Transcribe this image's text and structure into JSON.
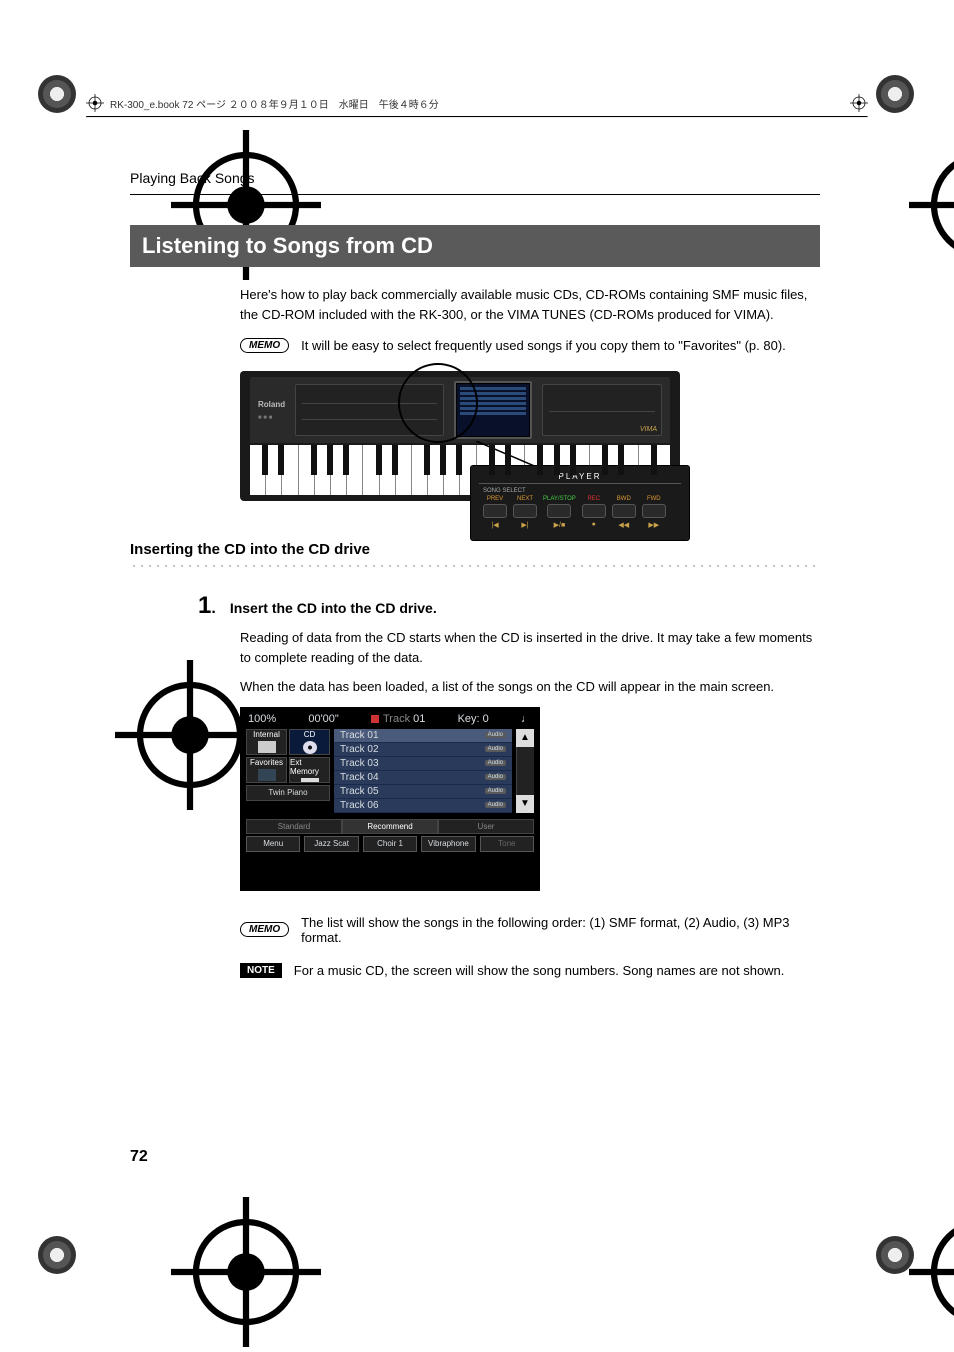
{
  "header": {
    "framemaker_line": "RK-300_e.book 72 ページ ２００８年９月１０日　水曜日　午後４時６分"
  },
  "running_head": "Playing Back Songs",
  "section_title": "Listening to Songs from CD",
  "intro": "Here's how to play back commercially available music CDs, CD-ROMs containing SMF music files, the CD-ROM included with the RK-300, or the VIMA TUNES (CD-ROMs produced for VIMA).",
  "memo_badge": "MEMO",
  "memo_1": "It will be easy to select frequently used songs if you copy them to \"Favorites\" (p. 80).",
  "figure1": {
    "brand": "Roland",
    "logo": "VIMA",
    "player_label": "PLAYER",
    "song_select_label": "SONG SELECT",
    "buttons": [
      {
        "label": "PREV",
        "sym": "|◀",
        "cls": "org"
      },
      {
        "label": "NEXT",
        "sym": "▶|",
        "cls": "org"
      },
      {
        "label": "PLAY/STOP",
        "sym": "▶/■",
        "cls": "grn"
      },
      {
        "label": "REC",
        "sym": "●",
        "cls": "red"
      },
      {
        "label": "BWD",
        "sym": "◀◀",
        "cls": "org"
      },
      {
        "label": "FWD",
        "sym": "▶▶",
        "cls": "org"
      }
    ]
  },
  "subheading": "Inserting the CD into the CD drive",
  "step": {
    "num": "1",
    "dot": ".",
    "title": "Insert the CD into the CD drive.",
    "body1": "Reading of data from the CD starts when the CD is inserted in the drive. It may take a few moments to complete reading of the data.",
    "body2": "When the data has been loaded, a list of the songs on the CD will appear in the main screen."
  },
  "screen2": {
    "top_left": "100%",
    "top_time": "00'00\"",
    "top_track_prefix": "Track ",
    "top_track_num": "01",
    "top_key": "Key: 0",
    "tiles": {
      "internal": "Internal",
      "cd": "CD",
      "favorites": "Favorites",
      "ext": "Ext Memory",
      "twin": "Twin Piano"
    },
    "tracks": [
      "Track 01",
      "Track 02",
      "Track 03",
      "Track 04",
      "Track 05",
      "Track 06"
    ],
    "audio_tag": "Audio",
    "tabs": [
      "Standard",
      "Recommend",
      "User"
    ],
    "bottom": [
      "Menu",
      "Jazz Scat",
      "Choir 1",
      "Vibraphone",
      "Tone"
    ]
  },
  "memo_2": "The list will show the songs in the following order: (1) SMF format, (2) Audio, (3) MP3 format.",
  "note_badge": "NOTE",
  "note_1": "For a music CD, the screen will show the song numbers. Song names are not shown.",
  "page_number": "72"
}
